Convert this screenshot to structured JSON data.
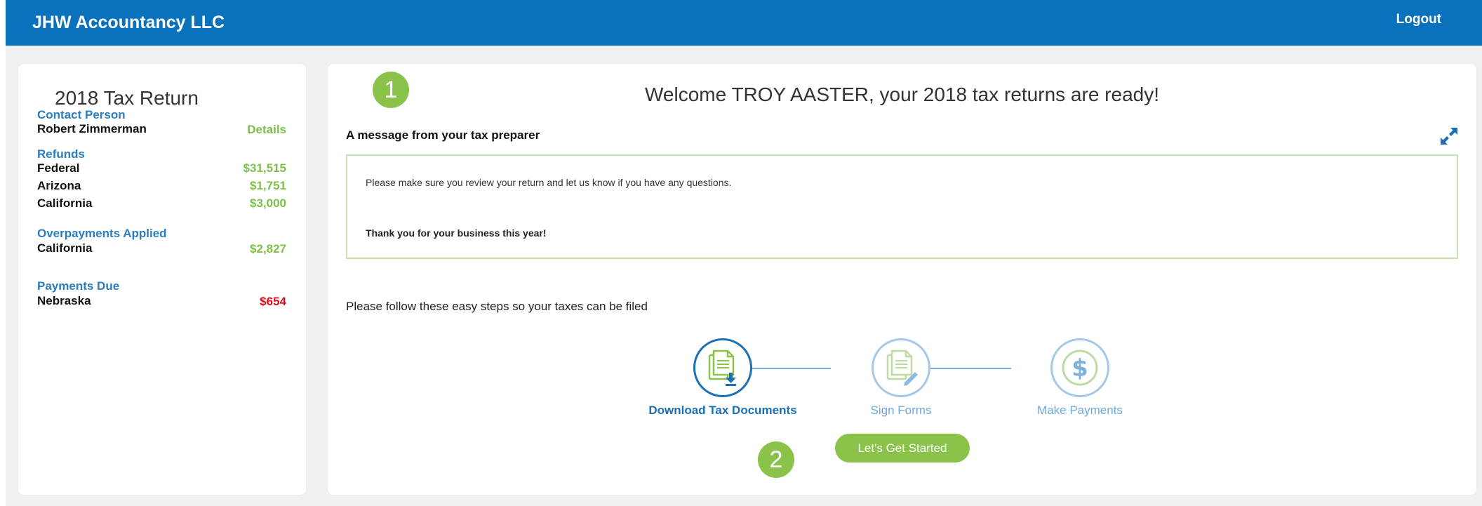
{
  "header": {
    "brand": "JHW Accountancy LLC",
    "logout_label": "Logout",
    "color": "#0a72bd"
  },
  "sidebar": {
    "title": "2018 Tax Return",
    "contact": {
      "heading": "Contact Person",
      "name": "Robert Zimmerman",
      "details_label": "Details"
    },
    "refunds": {
      "heading": "Refunds",
      "items": [
        {
          "label": "Federal",
          "value": "$31,515"
        },
        {
          "label": "Arizona",
          "value": "$1,751"
        },
        {
          "label": "California",
          "value": "$3,000"
        }
      ]
    },
    "overpayments": {
      "heading": "Overpayments Applied",
      "items": [
        {
          "label": "California",
          "value": "$2,827"
        }
      ]
    },
    "payments_due": {
      "heading": "Payments Due",
      "items": [
        {
          "label": "Nebraska",
          "value": "$654"
        }
      ]
    }
  },
  "main": {
    "badge1": "1",
    "badge2": "2",
    "welcome": "Welcome TROY AASTER, your 2018 tax returns are ready!",
    "message_title": "A message from your tax preparer",
    "message_line1": "Please make sure you review your return and let us know if you have any questions.",
    "message_line2": "Thank you for your business this year!",
    "steps_intro": "Please follow these easy steps so your taxes can be filed",
    "steps": [
      {
        "label": "Download Tax Documents",
        "icon": "download-document-icon",
        "active": true
      },
      {
        "label": "Sign Forms",
        "icon": "sign-document-icon",
        "active": false
      },
      {
        "label": "Make Payments",
        "icon": "dollar-icon",
        "active": false
      }
    ],
    "cta_label": "Let's Get Started"
  },
  "colors": {
    "accent_blue": "#1b6fb5",
    "green": "#8bc34a",
    "amount_green": "#7cc04a",
    "due_red": "#e0101a"
  }
}
